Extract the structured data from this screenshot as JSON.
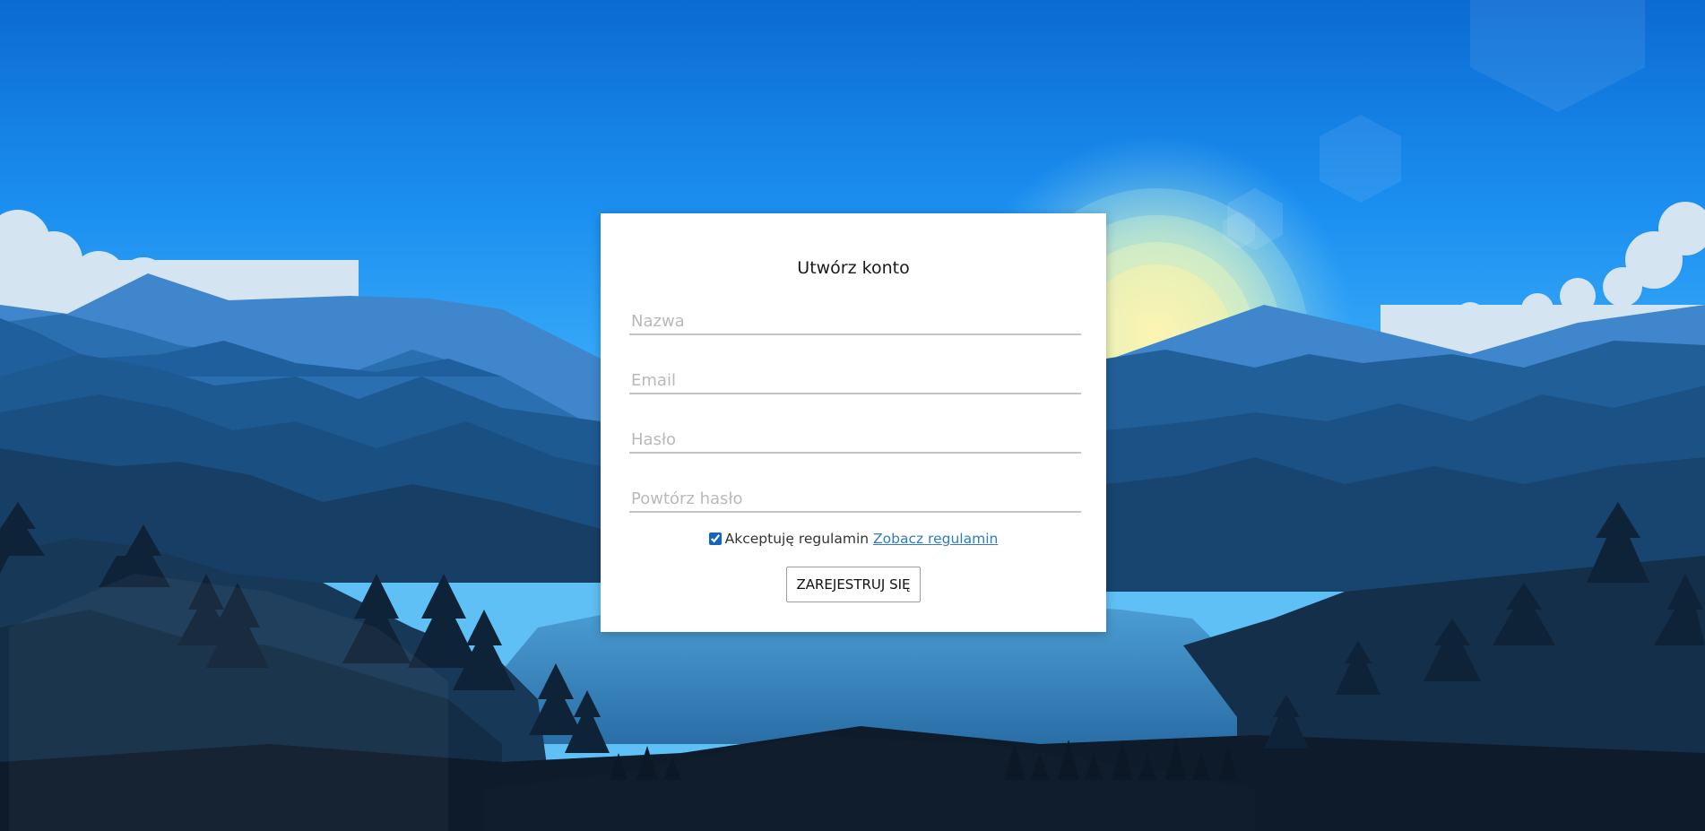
{
  "form": {
    "title": "Utwórz konto",
    "name_placeholder": "Nazwa",
    "email_placeholder": "Email",
    "password_placeholder": "Hasło",
    "repeat_password_placeholder": "Powtórz hasło",
    "terms_checked": true,
    "terms_text": "Akceptuję regulamin",
    "terms_link": "Zobacz regulamin",
    "submit_label": "ZAREJESTRUJ SIĘ"
  },
  "colors": {
    "sky_top": "#0a6fd6",
    "sky_mid": "#1e96f2",
    "sun": "#f3ea9a",
    "link": "#2f7bc9"
  }
}
